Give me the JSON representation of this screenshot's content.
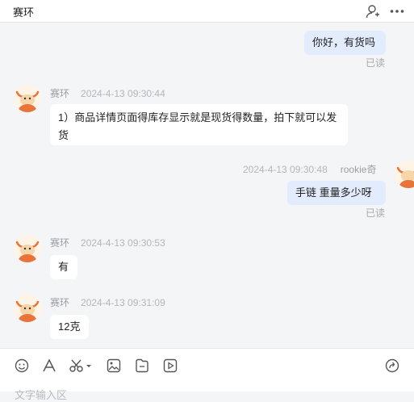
{
  "header": {
    "title": "赛环",
    "add_user_icon": "add-user-icon",
    "more_icon": "more-icon"
  },
  "messages": [
    {
      "side": "right",
      "text": "你好，有货吗",
      "status": "已读"
    },
    {
      "side": "left",
      "name": "赛环",
      "time": "2024-4-13 09:30:44",
      "text": "1）商品详情页面得库存显示就是现货得数量，拍下就可以发货"
    },
    {
      "side": "right",
      "name": "rookie奇",
      "time": "2024-4-13 09:30:48",
      "text": "手链  重量多少呀",
      "status": "已读"
    },
    {
      "side": "left",
      "name": "赛环",
      "time": "2024-4-13 09:30:53",
      "text": "有"
    },
    {
      "side": "left",
      "name": "赛环",
      "time": "2024-4-13 09:31:09",
      "text": "12克"
    }
  ],
  "toolbar": {
    "icons": [
      "emoji-icon",
      "font-icon",
      "scissors-icon",
      "image-icon",
      "file-icon",
      "video-icon",
      "share-icon"
    ],
    "input_placeholder": "文字输入区"
  },
  "colors": {
    "my_bubble": "#e3ecfd",
    "other_bubble": "#ffffff",
    "background": "#f4f5f7"
  }
}
